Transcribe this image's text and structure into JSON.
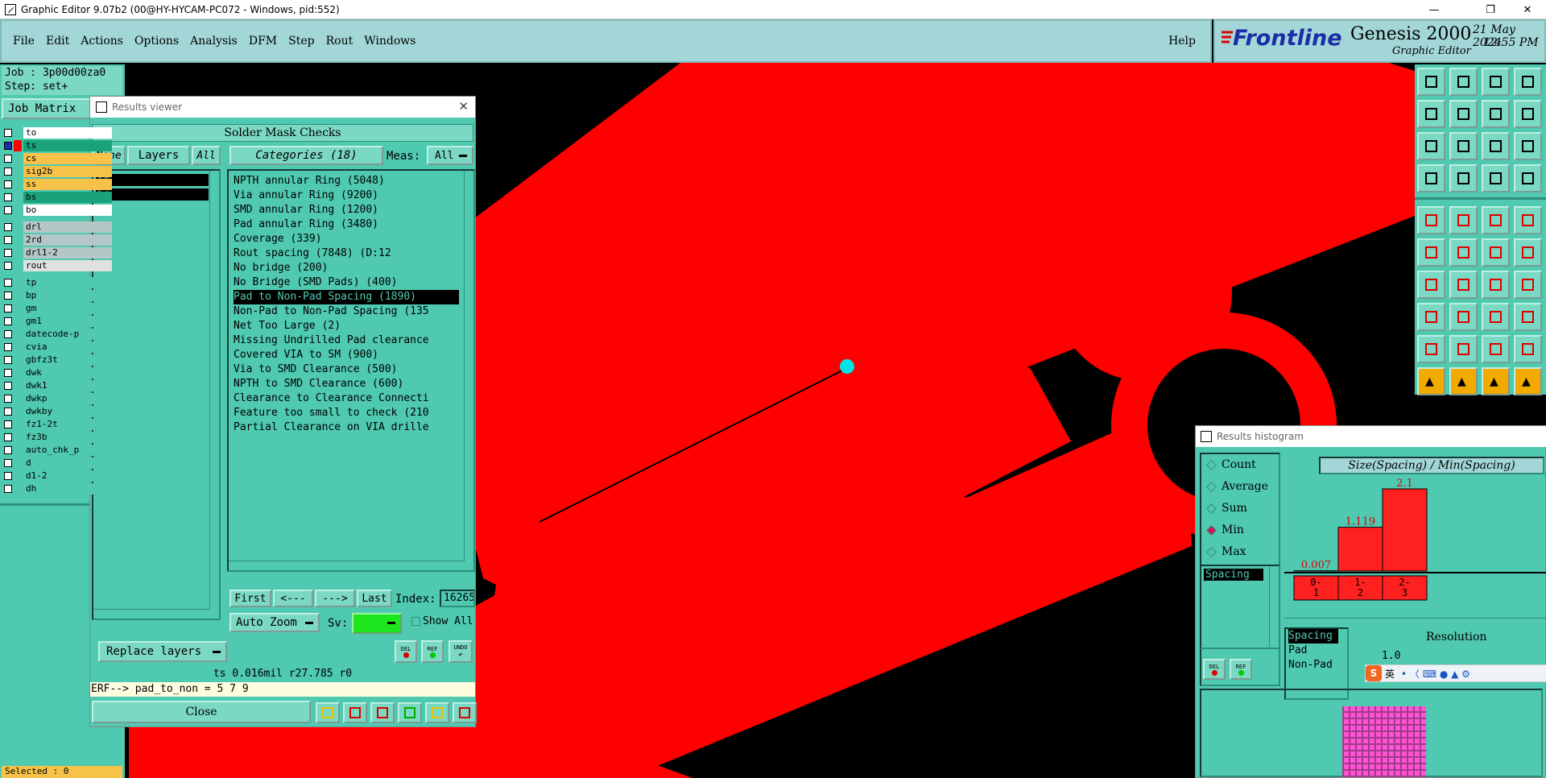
{
  "window": {
    "title": "Graphic Editor 9.07b2 (00@HY-HYCAM-PC072 - Windows, pid:552)"
  },
  "menu": {
    "items": [
      "File",
      "Edit",
      "Actions",
      "Options",
      "Analysis",
      "DFM",
      "Step",
      "Rout",
      "Windows"
    ],
    "help": "Help"
  },
  "brand": {
    "logo": "Frontline",
    "product": "Genesis 2000",
    "subtitle": "Graphic Editor",
    "date": "21 May 2024",
    "time": "12:55 PM"
  },
  "job": {
    "job_line": "Job : 3p00d00za0",
    "step_line": "Step: set+",
    "matrix_label": "Job Matrix",
    "selected": "Selected : 0"
  },
  "layers": [
    {
      "name": "to",
      "color": "#ffffff"
    },
    {
      "name": "ts",
      "color": "#1aa37a"
    },
    {
      "name": "cs",
      "color": "#f7c24a"
    },
    {
      "name": "sig2b",
      "color": "#f7c24a"
    },
    {
      "name": "ss",
      "color": "#f7c24a"
    },
    {
      "name": "bs",
      "color": "#1aa37a"
    },
    {
      "name": "bo",
      "color": "#ffffff"
    },
    {
      "name": "drl",
      "color": "#b5c6c6"
    },
    {
      "name": "2rd",
      "color": "#b5c6c6"
    },
    {
      "name": "drl1-2",
      "color": "#b5c6c6"
    },
    {
      "name": "rout",
      "color": "#e0e0e0"
    },
    {
      "name": "tp",
      "color": "#4fc9b0"
    },
    {
      "name": "bp",
      "color": "#4fc9b0"
    },
    {
      "name": "gm",
      "color": "#4fc9b0"
    },
    {
      "name": "gm1",
      "color": "#4fc9b0"
    },
    {
      "name": "datecode-p",
      "color": "#4fc9b0"
    },
    {
      "name": "cvia",
      "color": "#4fc9b0"
    },
    {
      "name": "gbfz3t",
      "color": "#4fc9b0"
    },
    {
      "name": "dwk",
      "color": "#4fc9b0"
    },
    {
      "name": "dwk1",
      "color": "#4fc9b0"
    },
    {
      "name": "dwkp",
      "color": "#4fc9b0"
    },
    {
      "name": "dwkby",
      "color": "#4fc9b0"
    },
    {
      "name": "fz1-2t",
      "color": "#4fc9b0"
    },
    {
      "name": "fz3b",
      "color": "#4fc9b0"
    },
    {
      "name": "auto_chk_p",
      "color": "#4fc9b0"
    },
    {
      "name": "d",
      "color": "#4fc9b0"
    },
    {
      "name": "d1-2",
      "color": "#4fc9b0"
    },
    {
      "name": "dh",
      "color": "#4fc9b0"
    }
  ],
  "results_viewer": {
    "title": "Results viewer",
    "heading": "Solder Mask Checks",
    "none_btn": "None",
    "layers_btn": "Layers",
    "all_btn": "All",
    "layer_list": [
      "ts",
      "bs"
    ],
    "categories_label": "Categories (18)",
    "meas_label": "Meas:",
    "meas_value": "All",
    "categories": [
      "NPTH annular Ring (5048)",
      "Via annular Ring (9200)",
      "SMD annular Ring (1200)",
      "Pad annular Ring (3480)",
      "Coverage (339)",
      "Rout spacing (7848)        (D:12",
      "No bridge (200)",
      "No Bridge (SMD Pads) (400)",
      "Pad to Non-Pad Spacing (1890)",
      "Non-Pad to Non-Pad Spacing (135",
      "Net Too Large (2)",
      "Missing Undrilled Pad clearance",
      "Covered VIA to SM (900)",
      "Via to SMD Clearance (500)",
      "NPTH to SMD Clearance (600)",
      "Clearance to Clearance Connecti",
      "Feature too small to check (210",
      "Partial Clearance on VIA drille"
    ],
    "selected_category": "Pad to Non-Pad Spacing (1890)",
    "first": "First",
    "prev": "<---",
    "next": "--->",
    "last": "Last",
    "index_label": "Index:",
    "index_value": "16265",
    "zoom": "Auto Zoom",
    "sv_label": "Sv:",
    "show_all": "Show All",
    "replace": "Replace layers",
    "status": "ts 0.016mil  r27.785  r0",
    "erf": "ERF--> pad_to_non = 5 7 9",
    "close": "Close",
    "tool_labels": {
      "del": "DEL",
      "ref": "REF",
      "undo": "UNDO"
    }
  },
  "histogram": {
    "title": "Results histogram",
    "options": [
      "Count",
      "Average",
      "Sum",
      "Min",
      "Max"
    ],
    "selected_option": "Min",
    "chart_title": "Size(Spacing) / Min(Spacing)",
    "list_item": "Spacing",
    "measures": [
      "Spacing",
      "Pad",
      "Non-Pad"
    ],
    "resolution_label": "Resolution",
    "resolution_value": "1.0",
    "tool_labels": {
      "del": "DEL",
      "ref": "REF"
    }
  },
  "chart_data": {
    "type": "bar",
    "categories": [
      "0-1",
      "1-2",
      "2-3"
    ],
    "values": [
      0.007,
      1.119,
      2.1
    ],
    "labels": [
      "0.007",
      "1.119",
      "2.1"
    ],
    "title": "Size(Spacing) / Min(Spacing)",
    "bar_color": "#ff2020"
  },
  "ime": {
    "label": "英"
  },
  "colors": {
    "panel": "#4fc9b0",
    "menu": "#a3d7d7",
    "feature": "#ff0000",
    "cursor": "#00e5e5"
  }
}
